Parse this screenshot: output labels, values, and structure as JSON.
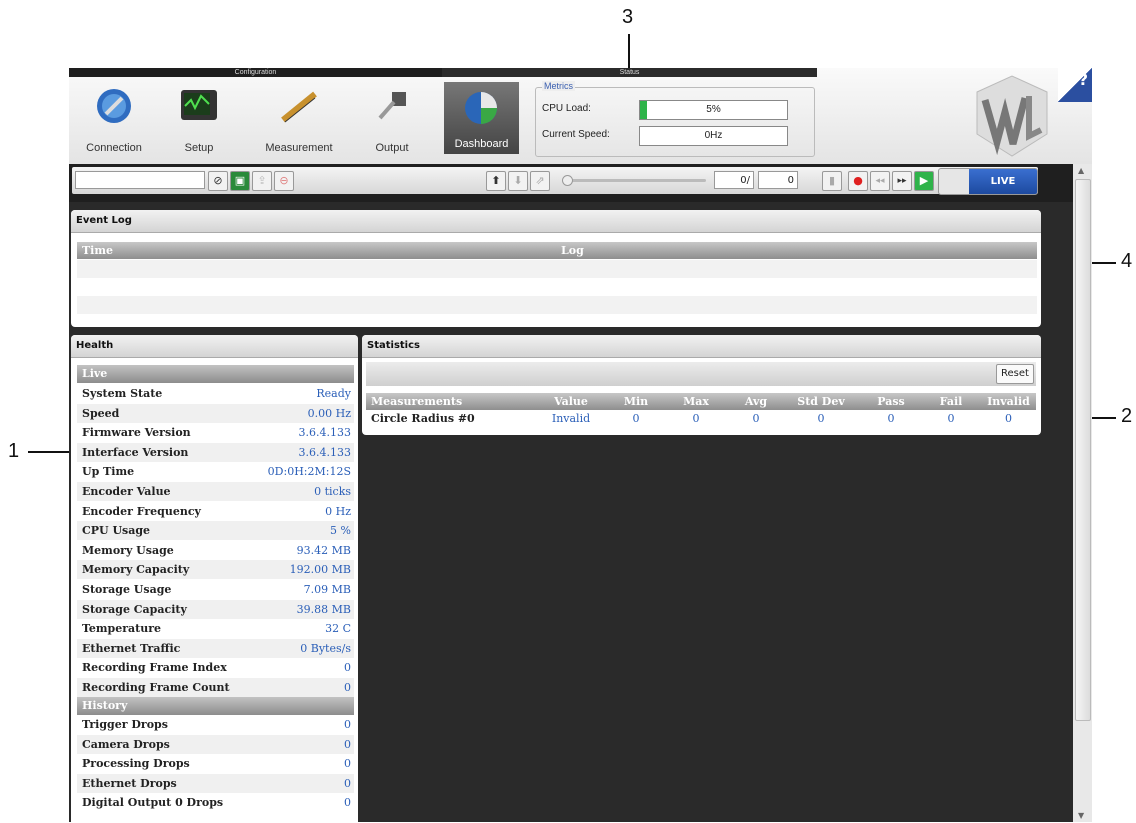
{
  "callouts": {
    "c1": "1",
    "c2": "2",
    "c3": "3",
    "c4": "4"
  },
  "header": {
    "config_label": "Configuration",
    "status_label": "Status"
  },
  "nav": {
    "connection": "Connection",
    "setup": "Setup",
    "measurement": "Measurement",
    "output": "Output",
    "dashboard": "Dashboard"
  },
  "metrics": {
    "legend": "Metrics",
    "cpu_label": "CPU Load:",
    "cpu_value": "5%",
    "cpu_fraction": 0.05,
    "speed_label": "Current Speed:",
    "speed_value": "0Hz"
  },
  "help_label": "?",
  "toolbar": {
    "frame_index": "0/",
    "frame_count": "0",
    "live_label": "LIVE"
  },
  "event_log": {
    "title": "Event Log",
    "columns": [
      "Time",
      "Log"
    ]
  },
  "health": {
    "title": "Health",
    "groups": [
      "Live",
      "History"
    ],
    "live_rows": [
      {
        "k": "System State",
        "v": "Ready"
      },
      {
        "k": "Speed",
        "v": "0.00 Hz"
      },
      {
        "k": "Firmware Version",
        "v": "3.6.4.133"
      },
      {
        "k": "Interface Version",
        "v": "3.6.4.133"
      },
      {
        "k": "Up Time",
        "v": "0D:0H:2M:12S"
      },
      {
        "k": "Encoder Value",
        "v": "0 ticks"
      },
      {
        "k": "Encoder Frequency",
        "v": "0 Hz"
      },
      {
        "k": "CPU Usage",
        "v": "5 %"
      },
      {
        "k": "Memory Usage",
        "v": "93.42 MB"
      },
      {
        "k": "Memory Capacity",
        "v": "192.00 MB"
      },
      {
        "k": "Storage Usage",
        "v": "7.09 MB"
      },
      {
        "k": "Storage Capacity",
        "v": "39.88 MB"
      },
      {
        "k": "Temperature",
        "v": "32 C"
      },
      {
        "k": "Ethernet Traffic",
        "v": "0 Bytes/s"
      },
      {
        "k": "Recording Frame Index",
        "v": "0"
      },
      {
        "k": "Recording Frame Count",
        "v": "0"
      }
    ],
    "history_rows": [
      {
        "k": "Trigger Drops",
        "v": "0"
      },
      {
        "k": "Camera Drops",
        "v": "0"
      },
      {
        "k": "Processing Drops",
        "v": "0"
      },
      {
        "k": "Ethernet Drops",
        "v": "0"
      },
      {
        "k": "Digital Output 0 Drops",
        "v": "0"
      }
    ]
  },
  "statistics": {
    "title": "Statistics",
    "reset_label": "Reset",
    "columns": [
      "Measurements",
      "Value",
      "Min",
      "Max",
      "Avg",
      "Std Dev",
      "Pass",
      "Fail",
      "Invalid"
    ],
    "rows": [
      [
        "Circle Radius #0",
        "Invalid",
        "0",
        "0",
        "0",
        "0",
        "0",
        "0",
        "0"
      ]
    ]
  }
}
